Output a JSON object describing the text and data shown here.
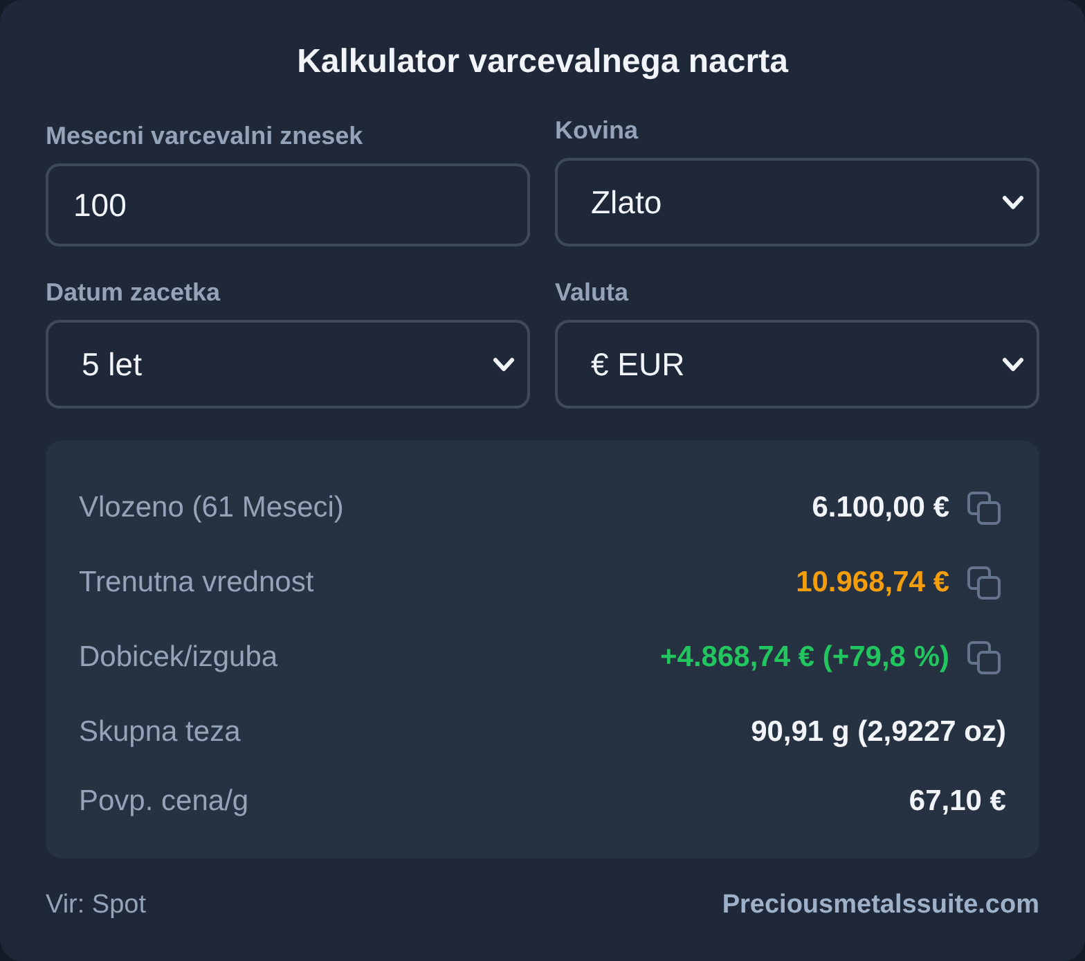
{
  "title": "Kalkulator varcevalnega nacrta",
  "fields": [
    {
      "kind": "input",
      "label": "Mesecni varcevalni znesek",
      "value": "100"
    },
    {
      "kind": "select",
      "label": "Kovina",
      "value": "Zlato"
    },
    {
      "kind": "select",
      "label": "Datum zacetka",
      "value": "5 let"
    },
    {
      "kind": "select",
      "label": "Valuta",
      "value": "€ EUR"
    }
  ],
  "results": [
    {
      "label": "Vlozeno (61 Meseci)",
      "value": "6.100,00 €",
      "color": "#f1f5f9",
      "copyable": true
    },
    {
      "label": "Trenutna vrednost",
      "value": "10.968,74 €",
      "color": "#f59e0b",
      "copyable": true
    },
    {
      "label": "Dobicek/izguba",
      "value": "+4.868,74 € (+79,8 %)",
      "color": "#22c55e",
      "copyable": true
    },
    {
      "label": "Skupna teza",
      "value": "90,91 g (2,9227 oz)",
      "color": "#f1f5f9",
      "copyable": false
    },
    {
      "label": "Povp. cena/g",
      "value": "67,10 €",
      "color": "#f1f5f9",
      "copyable": false
    }
  ],
  "footer": {
    "source": "Vir: Spot",
    "link": "Preciousmetalssuite.com"
  }
}
